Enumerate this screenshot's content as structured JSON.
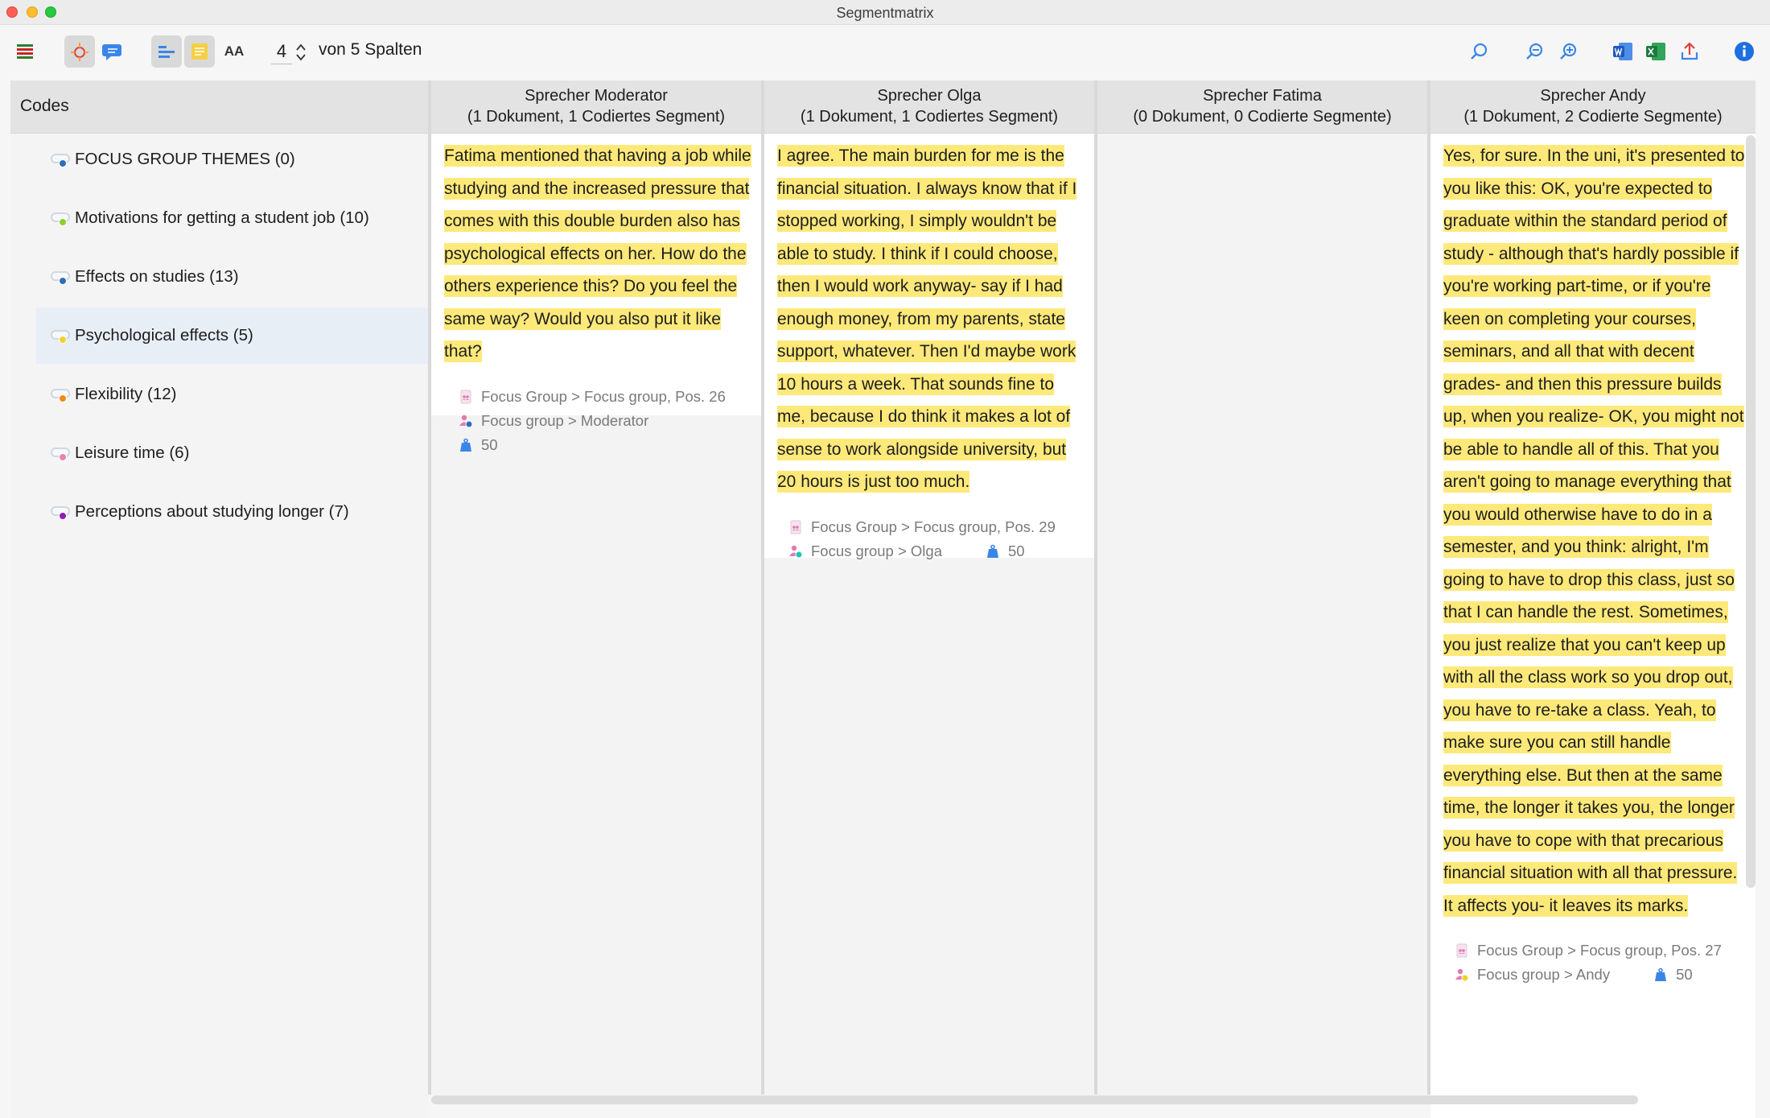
{
  "window": {
    "title": "Segmentmatrix"
  },
  "toolbar": {
    "icons": [
      "menu-icon",
      "code-segment-icon",
      "memo-bubble-icon",
      "align-icon",
      "sticky-note-icon",
      "font-size-icon",
      "search-icon",
      "zoom-out-icon",
      "zoom-in-icon",
      "word-export-icon",
      "excel-export-icon",
      "export-icon",
      "info-icon"
    ],
    "font_size_label": "AA",
    "columns_value": "4",
    "columns_suffix": "von 5 Spalten"
  },
  "codes": {
    "header": "Codes",
    "items": [
      {
        "label": "FOCUS GROUP THEMES (0)",
        "color": "#2f6fb8"
      },
      {
        "label": "Motivations for getting a student job (10)",
        "color": "#8ccf2a"
      },
      {
        "label": "Effects on studies (13)",
        "color": "#2f6fb8"
      },
      {
        "label": "Psychological effects (5)",
        "color": "#f2d22a",
        "selected": true
      },
      {
        "label": "Flexibility (12)",
        "color": "#f28a14"
      },
      {
        "label": "Leisure time (6)",
        "color": "#e585b2"
      },
      {
        "label": "Perceptions about studying longer (7)",
        "color": "#8e1fb0"
      }
    ]
  },
  "columns": [
    {
      "header": "Sprecher Moderator",
      "subheader": "(1 Dokument, 1 Codiertes Segment)",
      "segment": "Fatima mentioned that having a job while studying and the increased pressure that comes with this double burden also has psychological effects on her. How do the others experience this? Do you feel the same way? Would you also put it like that?",
      "source": "Focus Group > Focus group, Pos. 26",
      "speaker": "Focus group > Moderator",
      "weight": "50",
      "speaker_dot": "#2f6fb8"
    },
    {
      "header": "Sprecher Olga",
      "subheader": "(1 Dokument, 1 Codiertes Segment)",
      "segment": "I agree. The main burden for me is the financial situation. I always know that if I stopped working, I simply wouldn't be able to study. I think if I could choose, then I would work anyway- say if I had enough money, from my parents, state support, whatever. Then I'd maybe work 10 hours a week. That sounds fine to me, because I do think it makes a lot of sense to work alongside university, but 20 hours is just too much.",
      "source": "Focus Group > Focus group, Pos. 29",
      "speaker": "Focus group > Olga",
      "weight": "50",
      "speaker_dot": "#1fc4b8"
    },
    {
      "header": "Sprecher Fatima",
      "subheader": "(0 Dokument, 0 Codierte Segmente)"
    },
    {
      "header": "Sprecher Andy",
      "subheader": "(1 Dokument, 2 Codierte Segmente)",
      "segment": "Yes, for sure. In the uni, it's presented to you like this: OK, you're expected to graduate within the standard period of study - although that's hardly possible if you're working part-time, or if you're keen on completing your courses, seminars, and all that with decent grades- and then this pressure builds up, when you realize- OK, you might not be able to handle all of this. That you aren't going to manage everything that you would otherwise have to do in a semester, and you think: alright, I'm going to have to drop this class, just so that I can handle the rest. Sometimes, you just realize that you can't keep up with all the class work so you drop out, you have to re-take a class. Yeah, to make sure you can still handle everything else. But then at the same time, the longer it takes you, the longer you have to cope with that precarious financial situation with all that pressure. It affects you- it leaves its marks.",
      "source": "Focus Group > Focus group, Pos. 27",
      "speaker": "Focus group > Andy",
      "weight": "50",
      "speaker_dot": "#f2d22a"
    }
  ]
}
